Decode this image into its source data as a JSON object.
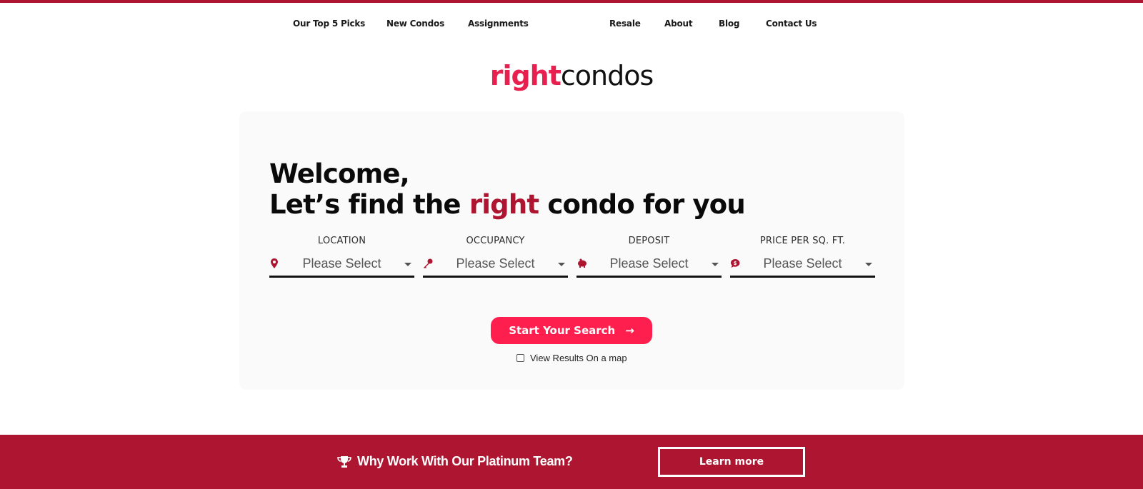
{
  "nav": {
    "items": [
      {
        "label": "Our Top 5 Picks"
      },
      {
        "label": "New Condos"
      },
      {
        "label": "Assignments"
      },
      {
        "label": "Resale"
      },
      {
        "label": "About"
      },
      {
        "label": "Blog"
      },
      {
        "label": "Contact Us"
      }
    ]
  },
  "logo": {
    "part1": "right",
    "part2": "condos"
  },
  "hero": {
    "line1": "Welcome,",
    "line2_pre": "Let’s find the ",
    "line2_accent": "right",
    "line2_post": " condo for you"
  },
  "filters": [
    {
      "label": "LOCATION",
      "value": "Please Select",
      "icon": "map-pin-icon"
    },
    {
      "label": "OCCUPANCY",
      "value": "Please Select",
      "icon": "key-icon"
    },
    {
      "label": "DEPOSIT",
      "value": "Please Select",
      "icon": "piggy-bank-icon"
    },
    {
      "label": "PRICE PER SQ. FT.",
      "value": "Please Select",
      "icon": "dollar-bubble-icon"
    }
  ],
  "search": {
    "button_label": "Start Your Search",
    "arrow": "→",
    "map_checkbox_label": "View Results On a map",
    "map_checked": false
  },
  "banner": {
    "text": "Why Work With Our Platinum Team?",
    "button_label": "Learn more"
  },
  "colors": {
    "brand": "#ad1530",
    "cta": "#ff1f4f",
    "logo_accent": "#e8204f"
  }
}
